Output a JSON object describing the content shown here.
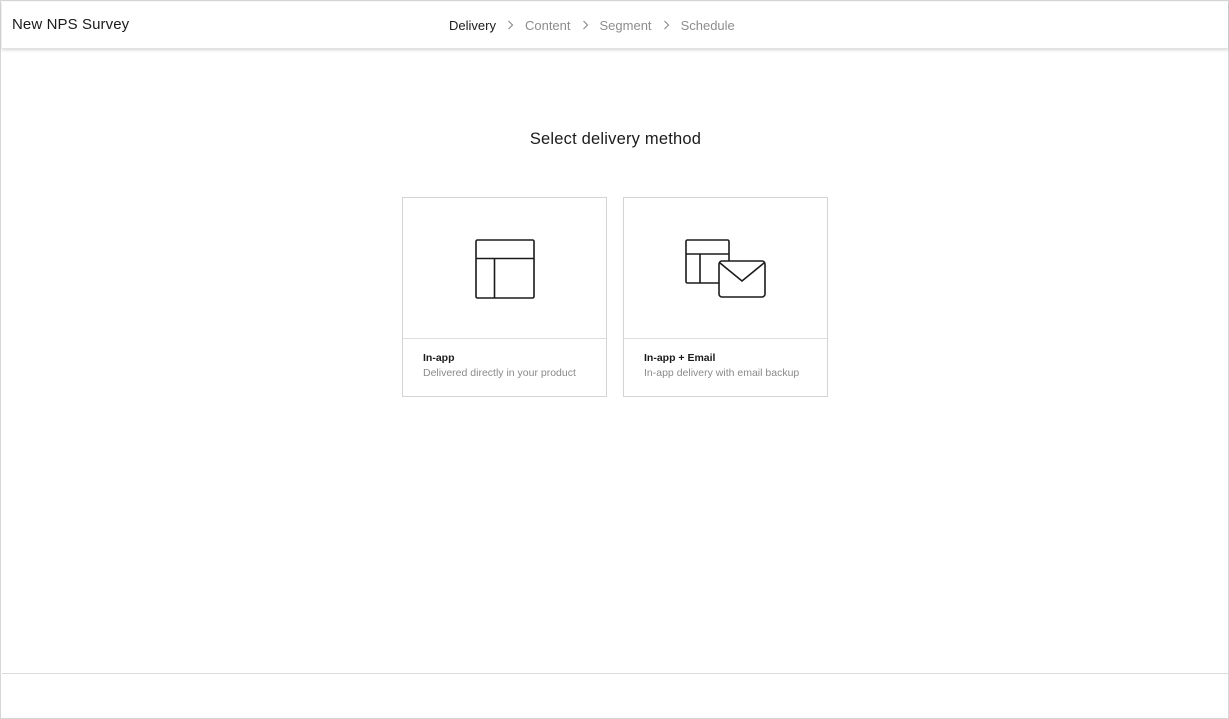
{
  "header": {
    "title": "New NPS Survey",
    "steps": [
      {
        "label": "Delivery",
        "state": "active"
      },
      {
        "label": "Content",
        "state": "inactive"
      },
      {
        "label": "Segment",
        "state": "inactive"
      },
      {
        "label": "Schedule",
        "state": "inactive"
      }
    ]
  },
  "main": {
    "heading": "Select delivery method",
    "options": [
      {
        "title": "In-app",
        "description": "Delivered directly in your product",
        "icon": "in-app-layout-icon"
      },
      {
        "title": "In-app + Email",
        "description": "In-app delivery with email backup",
        "icon": "in-app-email-icon"
      }
    ]
  },
  "colors": {
    "text_primary": "#1b1b1b",
    "text_muted": "#8d8d8d",
    "border": "#d4d4d4"
  }
}
